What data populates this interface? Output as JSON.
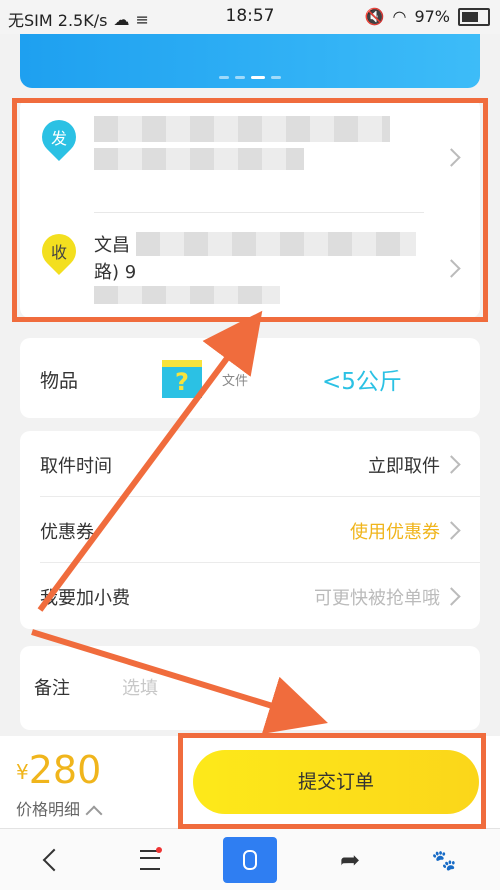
{
  "status_bar": {
    "carrier": "无SIM 2.5K/s",
    "time": "18:57",
    "battery": "97%"
  },
  "address": {
    "sender_tag": "发",
    "receiver_tag": "收",
    "receiver_line1": "文昌",
    "receiver_line2": "路) 9"
  },
  "item": {
    "label": "物品",
    "type": "文件",
    "weight": "<5公斤"
  },
  "options": [
    {
      "label": "取件时间",
      "value": "立即取件"
    },
    {
      "label": "优惠券",
      "value": "使用优惠券"
    },
    {
      "label": "我要加小费",
      "value": "可更快被抢单哦"
    }
  ],
  "note": {
    "label": "备注",
    "placeholder": "选填"
  },
  "price": {
    "currency": "¥",
    "amount": "280",
    "detail": "价格明细"
  },
  "submit_label": "提交订单",
  "colors": {
    "accent_blue": "#2bc1e4",
    "accent_yellow": "#f0b51c",
    "annotation_orange": "#f06c3d"
  }
}
